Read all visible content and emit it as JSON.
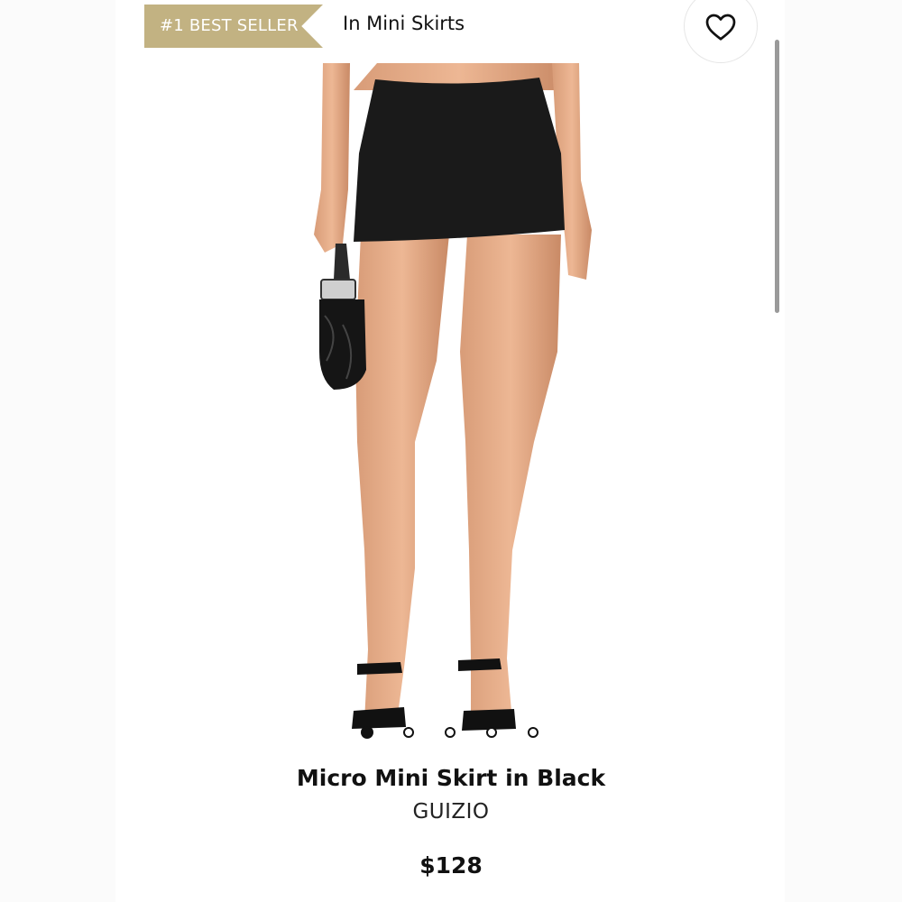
{
  "badge": {
    "label": "#1 BEST SELLER"
  },
  "category": {
    "label": "In Mini Skirts"
  },
  "favorite": {
    "icon": "heart-icon"
  },
  "carousel": {
    "total": 5,
    "active_index": 0
  },
  "product": {
    "title": "Micro Mini Skirt in Black",
    "brand": "GUIZIO",
    "price": "$128"
  },
  "colors": {
    "badge": "#c2b282",
    "text": "#111111"
  }
}
